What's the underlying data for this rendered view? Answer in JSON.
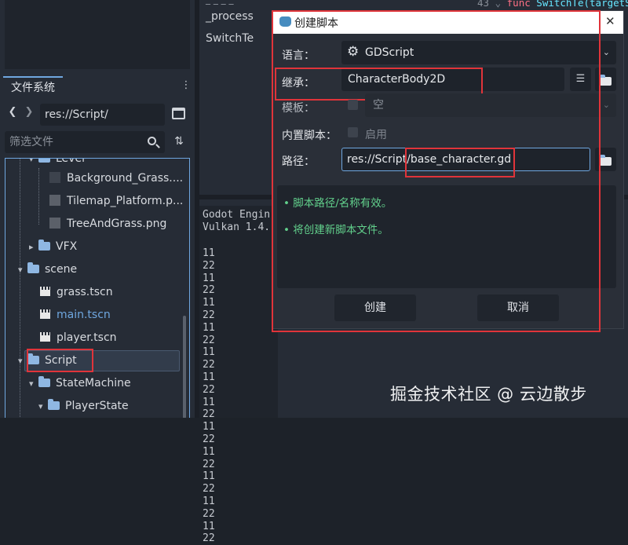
{
  "left_dock": {
    "tab_label": "文件系统",
    "nav_back": "❮",
    "nav_forward": "❯",
    "path": "res://Script/",
    "filter_placeholder": "筛选文件",
    "tree": [
      {
        "name": "Level",
        "type": "folder"
      },
      {
        "name": "Background_Grass....",
        "type": "image"
      },
      {
        "name": "Tilemap_Platform.p...",
        "type": "image"
      },
      {
        "name": "TreeAndGrass.png",
        "type": "image"
      },
      {
        "name": "VFX",
        "type": "folder"
      },
      {
        "name": "scene",
        "type": "folder"
      },
      {
        "name": "grass.tscn",
        "type": "scene"
      },
      {
        "name": "main.tscn",
        "type": "scene"
      },
      {
        "name": "player.tscn",
        "type": "scene"
      },
      {
        "name": "Script",
        "type": "folder"
      },
      {
        "name": "StateMachine",
        "type": "folder"
      },
      {
        "name": "PlayerState",
        "type": "folder"
      }
    ]
  },
  "script_list": {
    "items": [
      "_process",
      "SwitchTe"
    ]
  },
  "code": {
    "line_number": "43",
    "keyword": "func",
    "text": "SwitchTe(targetS"
  },
  "output": {
    "header_lines": [
      "Godot Engin",
      "Vulkan 1.4."
    ],
    "values": [
      "11",
      "22",
      "11",
      "22",
      "11",
      "22",
      "11",
      "22",
      "11",
      "22",
      "11",
      "22",
      "11",
      "22",
      "11",
      "22",
      "11",
      "22",
      "11",
      "22",
      "11",
      "22",
      "11",
      "22"
    ]
  },
  "dialog": {
    "title": "创建脚本",
    "close_label": "✕",
    "language_label": "语言：",
    "language_value": "GDScript",
    "inherits_label": "继承：",
    "inherits_value": "CharacterBody2D",
    "template_label": "模板：",
    "template_value": "空",
    "builtin_label": "内置脚本：",
    "builtin_value": "启用",
    "path_label": "路径：",
    "path_value": "res://Script/base_character.gd",
    "messages": [
      "• 脚本路径/名称有效。",
      "• 将创建新脚本文件。"
    ],
    "create_label": "创建",
    "cancel_label": "取消"
  },
  "watermark": "掘金技术社区 @ 云边散步",
  "colors": {
    "accent_blue": "#6fa7e0",
    "highlight_red": "#e0343a",
    "message_green": "#62d08c",
    "folder_blue": "#8fb7e2",
    "selected_item": "#6fa7e0"
  }
}
